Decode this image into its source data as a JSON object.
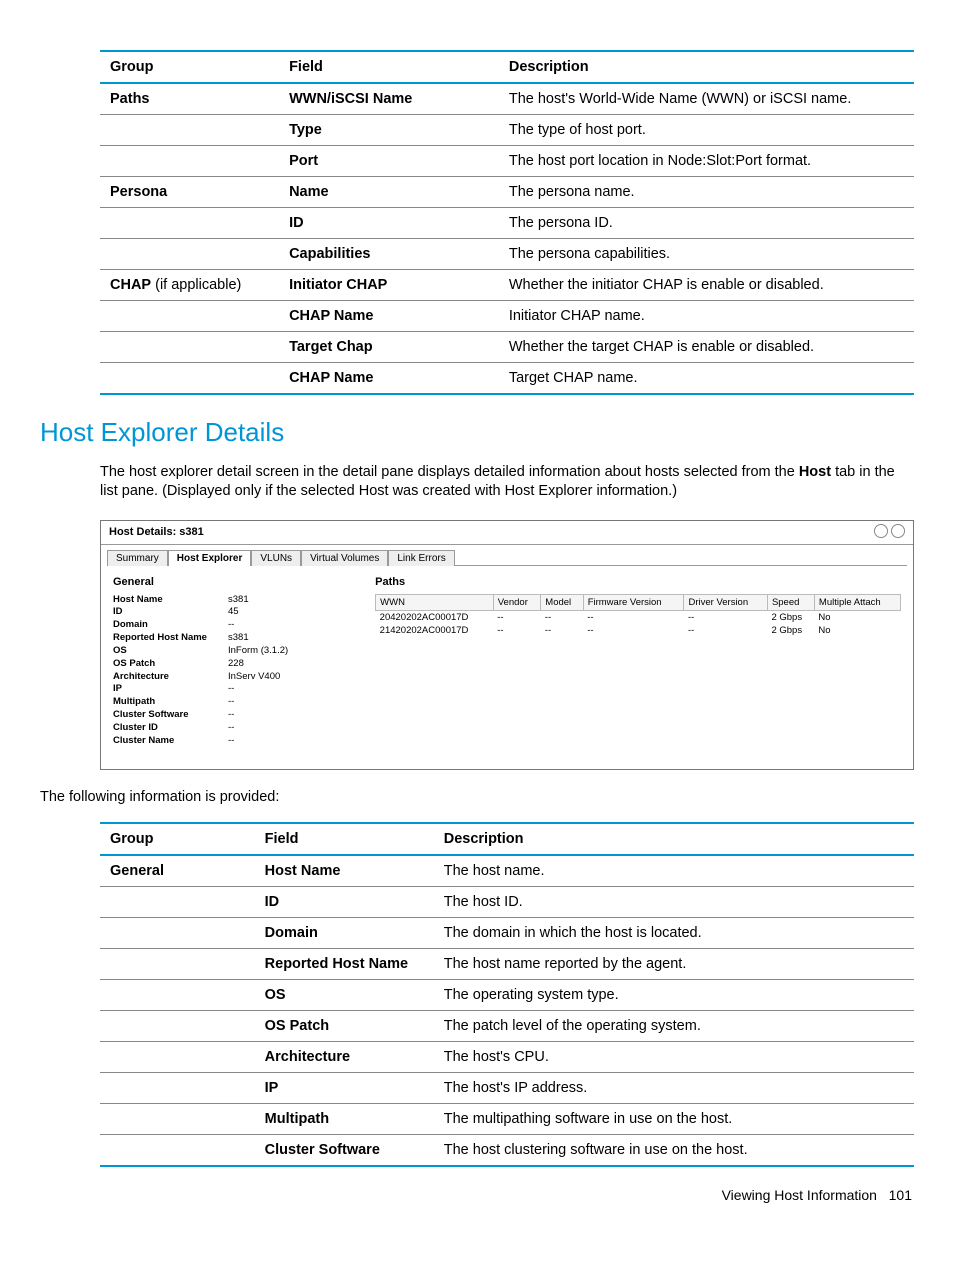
{
  "table1": {
    "headers": [
      "Group",
      "Field",
      "Description"
    ],
    "rows": [
      {
        "g": "Paths",
        "f": "WWN/iSCSI Name",
        "d": "The host's World-Wide Name (WWN) or iSCSI name."
      },
      {
        "g": "",
        "f": "Type",
        "d": "The type of host port."
      },
      {
        "g": "",
        "f": "Port",
        "d": "The host port location in Node:Slot:Port format."
      },
      {
        "g": "Persona",
        "f": "Name",
        "d": "The persona name."
      },
      {
        "g": "",
        "f": "ID",
        "d": "The persona ID."
      },
      {
        "g": "",
        "f": "Capabilities",
        "d": "The persona capabilities."
      },
      {
        "g": "CHAP",
        "gsuffix": " (if applicable)",
        "f": "Initiator CHAP",
        "d": "Whether the initiator CHAP is enable or disabled."
      },
      {
        "g": "",
        "f": "CHAP Name",
        "d": "Initiator CHAP name."
      },
      {
        "g": "",
        "f": "Target Chap",
        "d": "Whether the target CHAP is enable or disabled."
      },
      {
        "g": "",
        "f": "CHAP Name",
        "d": "Target CHAP name."
      }
    ]
  },
  "section_title": "Host Explorer Details",
  "para1_a": "The host explorer detail screen in the detail pane displays detailed information about hosts selected from the ",
  "para1_b": "Host",
  "para1_c": " tab in the list pane. (Displayed only if the selected Host was created with Host Explorer information.)",
  "panel": {
    "title": "Host Details: s381",
    "tabs": [
      "Summary",
      "Host Explorer",
      "VLUNs",
      "Virtual Volumes",
      "Link Errors"
    ],
    "general_title": "General",
    "general": [
      {
        "k": "Host Name",
        "v": "s381"
      },
      {
        "k": "ID",
        "v": "45"
      },
      {
        "k": "Domain",
        "v": "--"
      },
      {
        "k": "Reported Host Name",
        "v": "s381"
      },
      {
        "k": "OS",
        "v": "InForm (3.1.2)"
      },
      {
        "k": "OS Patch",
        "v": "228"
      },
      {
        "k": "Architecture",
        "v": "InServ V400"
      },
      {
        "k": "IP",
        "v": "--"
      },
      {
        "k": "Multipath",
        "v": "--"
      },
      {
        "k": "Cluster Software",
        "v": "--"
      },
      {
        "k": "Cluster ID",
        "v": "--"
      },
      {
        "k": "Cluster Name",
        "v": "--"
      }
    ],
    "paths_title": "Paths",
    "paths_headers": [
      "WWN",
      "Vendor",
      "Model",
      "Firmware Version",
      "Driver Version",
      "Speed",
      "Multiple Attach"
    ],
    "paths_rows": [
      [
        "20420202AC00017D",
        "--",
        "--",
        "--",
        "--",
        "2 Gbps",
        "No"
      ],
      [
        "21420202AC00017D",
        "--",
        "--",
        "--",
        "--",
        "2 Gbps",
        "No"
      ]
    ]
  },
  "para2": "The following information is provided:",
  "table2": {
    "headers": [
      "Group",
      "Field",
      "Description"
    ],
    "rows": [
      {
        "g": "General",
        "f": "Host Name",
        "d": "The host name."
      },
      {
        "g": "",
        "f": "ID",
        "d": "The host ID."
      },
      {
        "g": "",
        "f": "Domain",
        "d": "The domain in which the host is located."
      },
      {
        "g": "",
        "f": "Reported Host Name",
        "d": "The host name reported by the agent."
      },
      {
        "g": "",
        "f": "OS",
        "d": "The operating system type."
      },
      {
        "g": "",
        "f": "OS Patch",
        "d": "The patch level of the operating system."
      },
      {
        "g": "",
        "f": "Architecture",
        "d": "The host's CPU."
      },
      {
        "g": "",
        "f": "IP",
        "d": "The host's IP address."
      },
      {
        "g": "",
        "f": "Multipath",
        "d": "The multipathing software in use on the host."
      },
      {
        "g": "",
        "f": "Cluster Software",
        "d": "The host clustering software in use on the host."
      }
    ]
  },
  "footer_text": "Viewing Host Information",
  "footer_page": "101"
}
